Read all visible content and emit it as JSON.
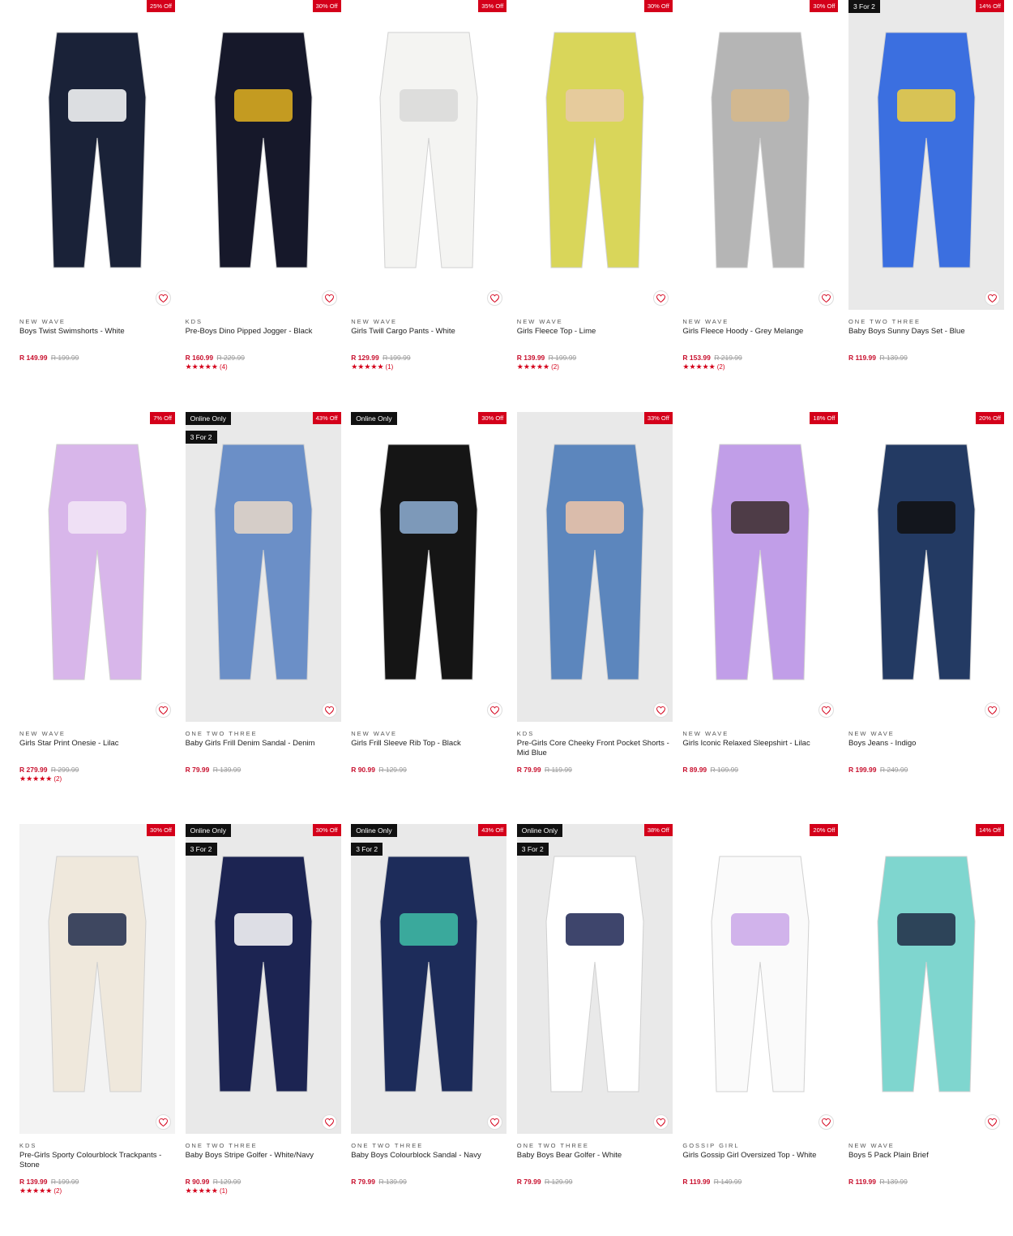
{
  "products": [
    {
      "brand": "NEW WAVE",
      "name": "Boys Twist Swimshorts - White",
      "price": "R 149.99",
      "was": "R 199.99",
      "discount": "25% Off",
      "tag1": "",
      "tag2": "",
      "stars": "",
      "reviews": "",
      "bg": "#ffffff",
      "color": "#1a2238",
      "accent": "#ffffff"
    },
    {
      "brand": "KDS",
      "name": "Pre-Boys Dino Pipped Jogger - Black",
      "price": "R 160.99",
      "was": "R 229.99",
      "discount": "30% Off",
      "tag1": "",
      "tag2": "",
      "stars": "★★★★★",
      "reviews": "(4)",
      "bg": "#ffffff",
      "color": "#16182a",
      "accent": "#e3b320"
    },
    {
      "brand": "NEW WAVE",
      "name": "Girls Twill Cargo Pants - White",
      "price": "R 129.99",
      "was": "R 199.99",
      "discount": "35% Off",
      "tag1": "",
      "tag2": "",
      "stars": "★★★★★",
      "reviews": "(1)",
      "bg": "#ffffff",
      "color": "#f4f4f2",
      "accent": "#d8d8d8"
    },
    {
      "brand": "NEW WAVE",
      "name": "Girls Fleece Top - Lime",
      "price": "R 139.99",
      "was": "R 199.99",
      "discount": "30% Off",
      "tag1": "",
      "tag2": "",
      "stars": "★★★★★",
      "reviews": "(2)",
      "bg": "#ffffff",
      "color": "#d9d65a",
      "accent": "#e8c9a8"
    },
    {
      "brand": "NEW WAVE",
      "name": "Girls Fleece Hoody - Grey Melange",
      "price": "R 153.99",
      "was": "R 219.99",
      "discount": "30% Off",
      "tag1": "",
      "tag2": "",
      "stars": "★★★★★",
      "reviews": "(2)",
      "bg": "#ffffff",
      "color": "#b5b5b5",
      "accent": "#d7b98a"
    },
    {
      "brand": "ONE TWO THREE",
      "name": "Baby Boys Sunny Days Set - Blue",
      "price": "R 119.99",
      "was": "R 139.99",
      "discount": "14% Off",
      "tag1": "3 For 2",
      "tag2": "",
      "stars": "",
      "reviews": "",
      "bg": "#e9e9e9",
      "color": "#3b6fe0",
      "accent": "#f4d23c"
    },
    {
      "brand": "NEW WAVE",
      "name": "Girls Star Print Onesie - Lilac",
      "price": "R 279.99",
      "was": "R 299.99",
      "discount": "7% Off",
      "tag1": "",
      "tag2": "",
      "stars": "★★★★★",
      "reviews": "(2)",
      "bg": "#ffffff",
      "color": "#d8b6ea",
      "accent": "#f3e7f7"
    },
    {
      "brand": "ONE TWO THREE",
      "name": "Baby Girls Frill Denim Sandal - Denim",
      "price": "R 79.99",
      "was": "R 139.99",
      "discount": "43% Off",
      "tag1": "Online Only",
      "tag2": "3 For 2",
      "stars": "",
      "reviews": "",
      "bg": "#e9e9e9",
      "color": "#6b8fc7",
      "accent": "#e8d8c8"
    },
    {
      "brand": "NEW WAVE",
      "name": "Girls Frill Sleeve Rib Top - Black",
      "price": "R 90.99",
      "was": "R 129.99",
      "discount": "30% Off",
      "tag1": "Online Only",
      "tag2": "",
      "stars": "",
      "reviews": "",
      "bg": "#ffffff",
      "color": "#151515",
      "accent": "#8fb0d6"
    },
    {
      "brand": "KDS",
      "name": "Pre-Girls Core Cheeky Front Pocket Shorts - Mid Blue",
      "price": "R 79.99",
      "was": "R 119.99",
      "discount": "33% Off",
      "tag1": "",
      "tag2": "",
      "stars": "",
      "reviews": "",
      "bg": "#e9e9e9",
      "color": "#5c86bd",
      "accent": "#f0c6a8"
    },
    {
      "brand": "NEW WAVE",
      "name": "Girls Iconic Relaxed Sleepshirt - Lilac",
      "price": "R 89.99",
      "was": "R 109.99",
      "discount": "18% Off",
      "tag1": "",
      "tag2": "",
      "stars": "",
      "reviews": "",
      "bg": "#ffffff",
      "color": "#c19ee8",
      "accent": "#3a2a2a"
    },
    {
      "brand": "NEW WAVE",
      "name": "Boys Jeans - Indigo",
      "price": "R 199.99",
      "was": "R 249.99",
      "discount": "20% Off",
      "tag1": "",
      "tag2": "",
      "stars": "",
      "reviews": "",
      "bg": "#ffffff",
      "color": "#233a63",
      "accent": "#111111"
    },
    {
      "brand": "KDS",
      "name": "Pre-Girls Sporty Colourblock Trackpants - Stone",
      "price": "R 139.99",
      "was": "R 199.99",
      "discount": "30% Off",
      "tag1": "",
      "tag2": "",
      "stars": "★★★★★",
      "reviews": "(2)",
      "bg": "#f3f3f3",
      "color": "#efe8dc",
      "accent": "#1f2a4a"
    },
    {
      "brand": "ONE TWO THREE",
      "name": "Baby Boys Stripe Golfer - White/Navy",
      "price": "R 90.99",
      "was": "R 129.99",
      "discount": "30% Off",
      "tag1": "Online Only",
      "tag2": "3 For 2",
      "stars": "★★★★★",
      "reviews": "(1)",
      "bg": "#e9e9e9",
      "color": "#1c2452",
      "accent": "#ffffff"
    },
    {
      "brand": "ONE TWO THREE",
      "name": "Baby Boys Colourblock Sandal - Navy",
      "price": "R 79.99",
      "was": "R 139.99",
      "discount": "43% Off",
      "tag1": "Online Only",
      "tag2": "3 For 2",
      "stars": "",
      "reviews": "",
      "bg": "#e9e9e9",
      "color": "#1d2c5a",
      "accent": "#3fbfa8"
    },
    {
      "brand": "ONE TWO THREE",
      "name": "Baby Boys Bear Golfer - White",
      "price": "R 79.99",
      "was": "R 129.99",
      "discount": "38% Off",
      "tag1": "Online Only",
      "tag2": "3 For 2",
      "stars": "",
      "reviews": "",
      "bg": "#e9e9e9",
      "color": "#ffffff",
      "accent": "#1c2452"
    },
    {
      "brand": "GOSSIP GIRL",
      "name": "Girls Gossip Girl Oversized Top - White",
      "price": "R 119.99",
      "was": "R 149.99",
      "discount": "20% Off",
      "tag1": "",
      "tag2": "",
      "stars": "",
      "reviews": "",
      "bg": "#ffffff",
      "color": "#fafafa",
      "accent": "#c9a6e8"
    },
    {
      "brand": "NEW WAVE",
      "name": "Boys 5 Pack Plain Brief",
      "price": "R 119.99",
      "was": "R 139.99",
      "discount": "14% Off",
      "tag1": "",
      "tag2": "",
      "stars": "",
      "reviews": "",
      "bg": "#ffffff",
      "color": "#7fd6cf",
      "accent": "#1f2a44"
    }
  ]
}
